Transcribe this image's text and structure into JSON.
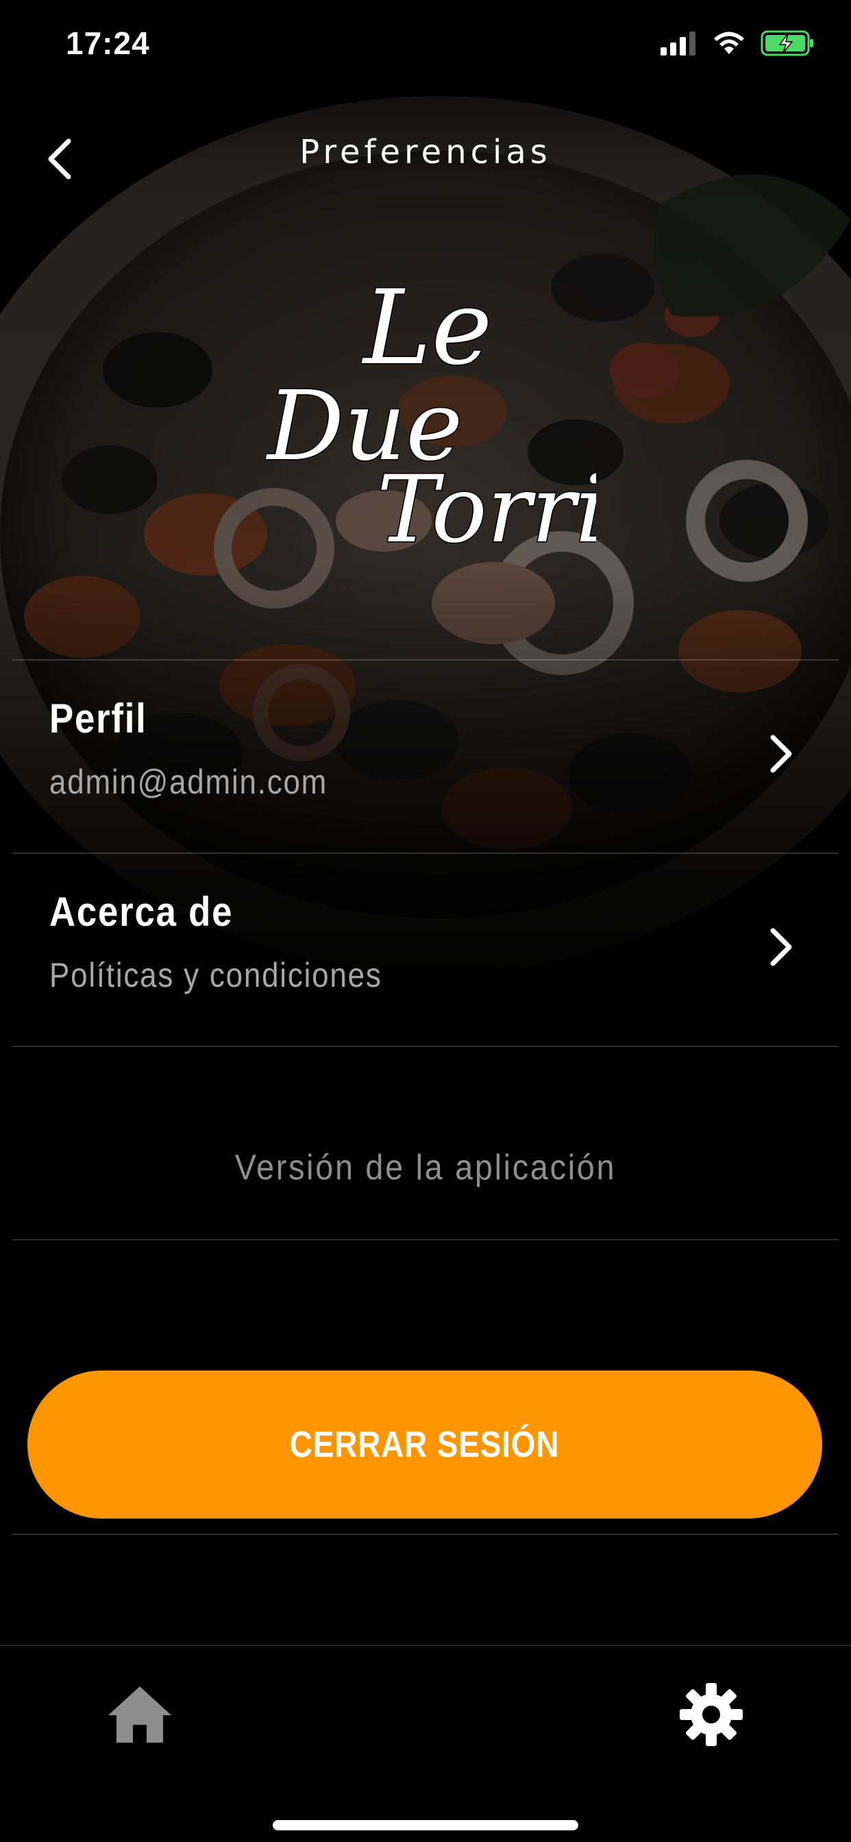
{
  "status_bar": {
    "time": "17:24",
    "icons": [
      "cellular-signal-icon",
      "wifi-icon",
      "battery-charging-icon"
    ],
    "battery_color": "#4cd964"
  },
  "header": {
    "title": "Preferencias",
    "back_icon": "chevron-left-icon"
  },
  "logo": {
    "line1": "Le",
    "line2": "Due",
    "line3": "Torri"
  },
  "menu": {
    "items": [
      {
        "title": "Perfil",
        "subtitle": "admin@admin.com",
        "icon": "chevron-right-icon"
      },
      {
        "title": "Acerca de",
        "subtitle": "Políticas y condiciones",
        "icon": "chevron-right-icon"
      }
    ],
    "version_label": "Versión de la aplicación"
  },
  "logout": {
    "label": "CERRAR SESIÓN",
    "color": "#ff9500"
  },
  "tab_bar": {
    "tabs": [
      {
        "name": "home",
        "icon": "home-icon",
        "color": "#8e8e8e"
      },
      {
        "name": "settings",
        "icon": "gear-icon",
        "color": "#ffffff",
        "active": true
      }
    ]
  }
}
